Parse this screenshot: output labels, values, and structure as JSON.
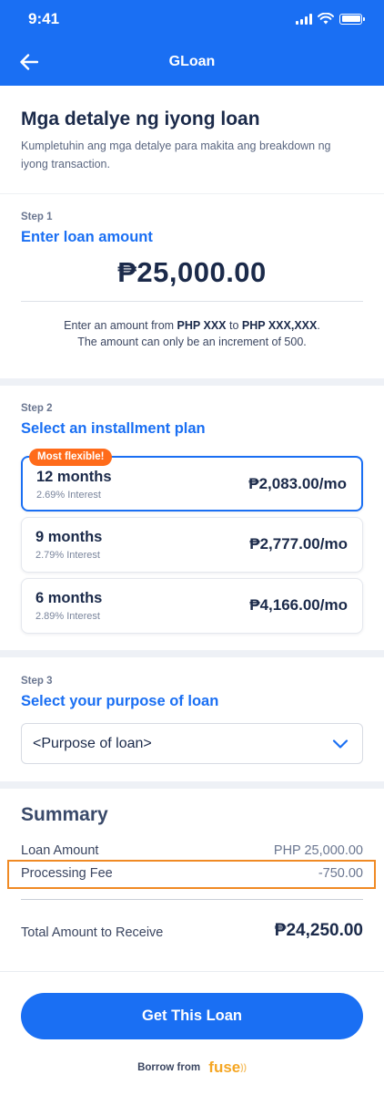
{
  "status_bar": {
    "time": "9:41"
  },
  "header": {
    "title": "GLoan"
  },
  "intro": {
    "title": "Mga detalye ng iyong loan",
    "subtitle": "Kumpletuhin ang mga detalye para makita ang breakdown ng iyong transaction."
  },
  "step1": {
    "label": "Step 1",
    "title": "Enter loan amount",
    "amount": "₱25,000.00",
    "hint_prefix": "Enter an amount from ",
    "hint_min": "PHP XXX",
    "hint_mid": " to ",
    "hint_max": "PHP XXX,XXX",
    "hint_suffix": ".",
    "hint_line2": "The amount can only be an increment of 500."
  },
  "step2": {
    "label": "Step 2",
    "title": "Select an installment plan",
    "badge": "Most flexible!",
    "plans": [
      {
        "months": "12 months",
        "interest": "2.69% Interest",
        "price": "₱2,083.00/mo",
        "selected": true
      },
      {
        "months": "9 months",
        "interest": "2.79% Interest",
        "price": "₱2,777.00/mo",
        "selected": false
      },
      {
        "months": "6 months",
        "interest": "2.89% Interest",
        "price": "₱4,166.00/mo",
        "selected": false
      }
    ]
  },
  "step3": {
    "label": "Step 3",
    "title": "Select your purpose of loan",
    "select_value": "<Purpose of loan>"
  },
  "summary": {
    "title": "Summary",
    "loan_amount_label": "Loan Amount",
    "loan_amount_value": "PHP 25,000.00",
    "processing_fee_label": "Processing Fee",
    "processing_fee_value": "-750.00",
    "total_label": "Total Amount to Receive",
    "total_value": "₱24,250.00"
  },
  "footer": {
    "cta_label": "Get This Loan",
    "borrow_label": "Borrow from",
    "brand": "fuse"
  },
  "colors": {
    "primary": "#1a6ff3",
    "badge": "#ff6b1a",
    "highlight": "#f08a24",
    "brand": "#f5a623"
  }
}
